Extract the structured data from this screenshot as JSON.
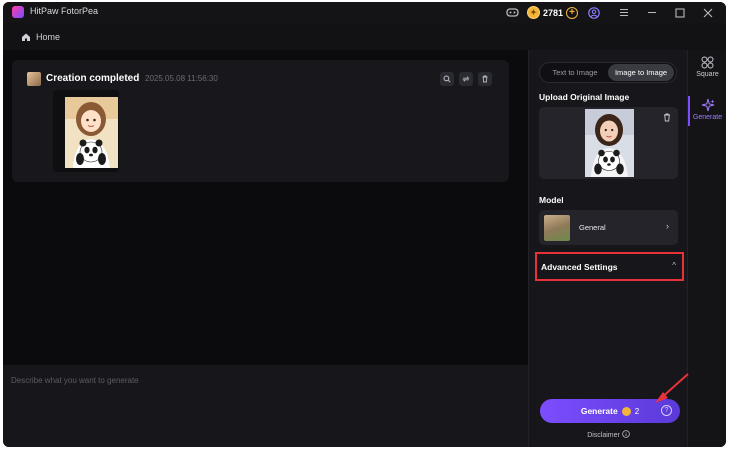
{
  "app": {
    "title": "HitPaw FotorPea",
    "coins": "2781"
  },
  "titlebar_icons": [
    "discord-icon",
    "coin-icon",
    "plus-icon",
    "user-icon",
    "menu-icon",
    "minimize-icon",
    "maximize-icon",
    "close-icon"
  ],
  "breadcrumb": {
    "home_label": "Home"
  },
  "result": {
    "title": "Creation completed",
    "date": "2025.05.08",
    "time": "11:56:30",
    "actions": [
      "zoom-icon",
      "regenerate-icon",
      "delete-icon"
    ]
  },
  "prompt": {
    "placeholder": "Describe what you want to generate"
  },
  "side_panel": {
    "mode_tabs": [
      {
        "label": "Text to Image",
        "active": false
      },
      {
        "label": "Image to Image",
        "active": true
      }
    ],
    "upload_label": "Upload Original Image",
    "model_label": "Model",
    "model_value": "General",
    "advanced_label": "Advanced Settings",
    "generate_label": "Generate",
    "generate_cost": "2",
    "disclaimer": "Disclaimer"
  },
  "rail": {
    "items": [
      {
        "label": "Square",
        "active": false
      },
      {
        "label": "Generate",
        "active": true
      }
    ]
  },
  "colors": {
    "accent": "#7c4dff",
    "highlight_box": "#e8323a",
    "coin": "#f3b43a"
  }
}
